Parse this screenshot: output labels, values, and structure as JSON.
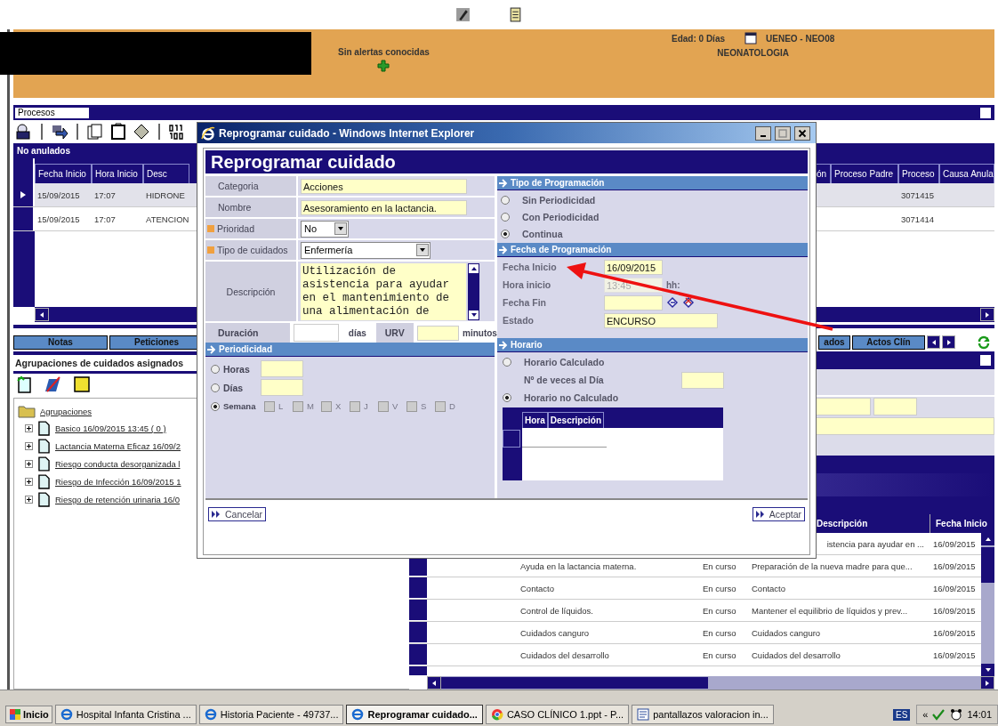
{
  "header": {
    "alert": "Sin alertas conocidas",
    "age": "Edad: 0 Días",
    "unit": "UENEO - NEO08",
    "service": "NEONATOLOGIA"
  },
  "procesos": {
    "tab": "Procesos",
    "panel_checked": false,
    "section": "No anulados",
    "columns_left": [
      "Fecha Inicio",
      "Hora Inicio",
      "Desc"
    ],
    "columns_right": [
      "ón",
      "Proceso Padre",
      "Proceso",
      "Causa Anula"
    ],
    "rows": [
      {
        "selected": true,
        "fecha": "15/09/2015",
        "hora": "17:07",
        "desc": "HIDRONE",
        "proceso": "3071415"
      },
      {
        "selected": false,
        "fecha": "15/09/2015",
        "hora": "17:07",
        "desc": "ATENCION",
        "proceso": "3071414"
      }
    ]
  },
  "tabs_left": [
    {
      "label": "Notas"
    },
    {
      "label": "Peticiones"
    }
  ],
  "tabs_right": [
    {
      "label": "ados"
    },
    {
      "label": "Actos Clín"
    }
  ],
  "agrupaciones": {
    "title": "Agrupaciones de cuidados asignados",
    "tree": {
      "label": "Agrupaciones",
      "children": [
        {
          "label": "Basico 16/09/2015 13:45 ( 0 )"
        },
        {
          "label": "Lactancia Materna Eficaz 16/09/2"
        },
        {
          "label": "Riesgo conducta desorganizada l"
        },
        {
          "label": "Riesgo de Infección 16/09/2015 1"
        },
        {
          "label": "Riesgo de retención urinaria 16/0"
        }
      ]
    }
  },
  "cuidados": {
    "panel_checked": false,
    "columns": [
      "Descripción",
      "Fecha Inicio"
    ],
    "rows": [
      {
        "descripcion": "istencia para ayudar en ...",
        "fecha": "16/09/2015"
      },
      {
        "nombre": "Ayuda en la lactancia materna.",
        "estado": "En curso",
        "descripcion": "Preparación de la nueva madre para que...",
        "fecha": "16/09/2015"
      },
      {
        "nombre": "Contacto",
        "estado": "En curso",
        "descripcion": "Contacto",
        "fecha": "16/09/2015"
      },
      {
        "nombre": "Control de líquidos.",
        "estado": "En curso",
        "descripcion": "Mantener el equilibrio de líquidos y prev...",
        "fecha": "16/09/2015"
      },
      {
        "nombre": "Cuidados canguro",
        "estado": "En curso",
        "descripcion": "Cuidados canguro",
        "fecha": "16/09/2015"
      },
      {
        "nombre": "Cuidados del desarrollo",
        "estado": "En curso",
        "descripcion": "Cuidados del desarrollo",
        "fecha": "16/09/2015"
      }
    ]
  },
  "dialog": {
    "title": "Reprogramar cuidado - Windows Internet Explorer",
    "heading": "Reprogramar cuidado",
    "fields": [
      {
        "kind": "text",
        "label": "Categoria",
        "required": false,
        "value": "Acciones"
      },
      {
        "kind": "text",
        "label": "Nombre",
        "required": false,
        "value": "Asesoramiento en la lactancia."
      },
      {
        "kind": "select",
        "label": "Prioridad",
        "required": true,
        "value": "No"
      },
      {
        "kind": "select_wide",
        "label": "Tipo de cuidados",
        "required": true,
        "value": "Enfermería"
      },
      {
        "kind": "textarea",
        "label": "Descripción",
        "required": false,
        "value": "Utilización de asistencia para ayudar en el mantenimiento de una alimentación de"
      }
    ],
    "duration": {
      "label": "Duración",
      "unit": "días",
      "urv_label": "URV",
      "urv_unit": "minutos"
    },
    "periodicidad": {
      "title": "Periodicidad",
      "options": [
        {
          "kind": "field",
          "label": "Horas",
          "selected": false
        },
        {
          "kind": "field",
          "label": "Días",
          "selected": false
        },
        {
          "kind": "days",
          "label": "Semana",
          "selected": true,
          "days": [
            {
              "label": "L",
              "checked": false
            },
            {
              "label": "M",
              "checked": false
            },
            {
              "label": "X",
              "checked": false
            },
            {
              "label": "J",
              "checked": false
            },
            {
              "label": "V",
              "checked": false
            },
            {
              "label": "S",
              "checked": false
            },
            {
              "label": "D",
              "checked": false
            }
          ]
        }
      ]
    },
    "tipo": {
      "title": "Tipo de Programación",
      "options": [
        {
          "label": "Sin Periodicidad",
          "selected": false
        },
        {
          "label": "Con Periodicidad",
          "selected": false
        },
        {
          "label": "Continua",
          "selected": true
        }
      ]
    },
    "fecha": {
      "title": "Fecha de Programación",
      "fields": [
        {
          "kind": "date",
          "label": "Fecha Inicio",
          "value": "16/09/2015",
          "disabled": false
        },
        {
          "kind": "time",
          "label": "Hora inicio",
          "value": "13:45",
          "hint": "hh:",
          "disabled": true
        },
        {
          "kind": "picker",
          "label": "Fecha Fin",
          "disabled": false
        },
        {
          "kind": "wide",
          "label": "Estado",
          "value": "ENCURSO",
          "disabled": false
        }
      ]
    },
    "horario": {
      "title": "Horario",
      "items": [
        {
          "kind": "radio",
          "label": "Horario Calculado",
          "selected": false
        },
        {
          "kind": "field",
          "label": "Nº de veces al Día"
        },
        {
          "kind": "radio",
          "label": "Horario no Calculado",
          "selected": true
        }
      ],
      "columns": [
        "Hora",
        "Descripción"
      ]
    },
    "buttons": [
      "Cancelar",
      "Aceptar"
    ]
  },
  "taskbar": {
    "start": "Inicio",
    "tasks": [
      {
        "kind": "ie",
        "label": "Hospital Infanta Cristina ...",
        "selected": false
      },
      {
        "kind": "ie",
        "label": "Historia Paciente - 49737...",
        "selected": false
      },
      {
        "kind": "ie",
        "label": "Reprogramar cuidado...",
        "selected": true
      },
      {
        "kind": "chrome",
        "label": "CASO CLÍNICO 1.ppt - P...",
        "selected": false
      },
      {
        "kind": "doc",
        "label": "pantallazos valoracion in...",
        "selected": false
      }
    ],
    "lang": "ES",
    "chevron": "«",
    "clock": "14:01"
  }
}
